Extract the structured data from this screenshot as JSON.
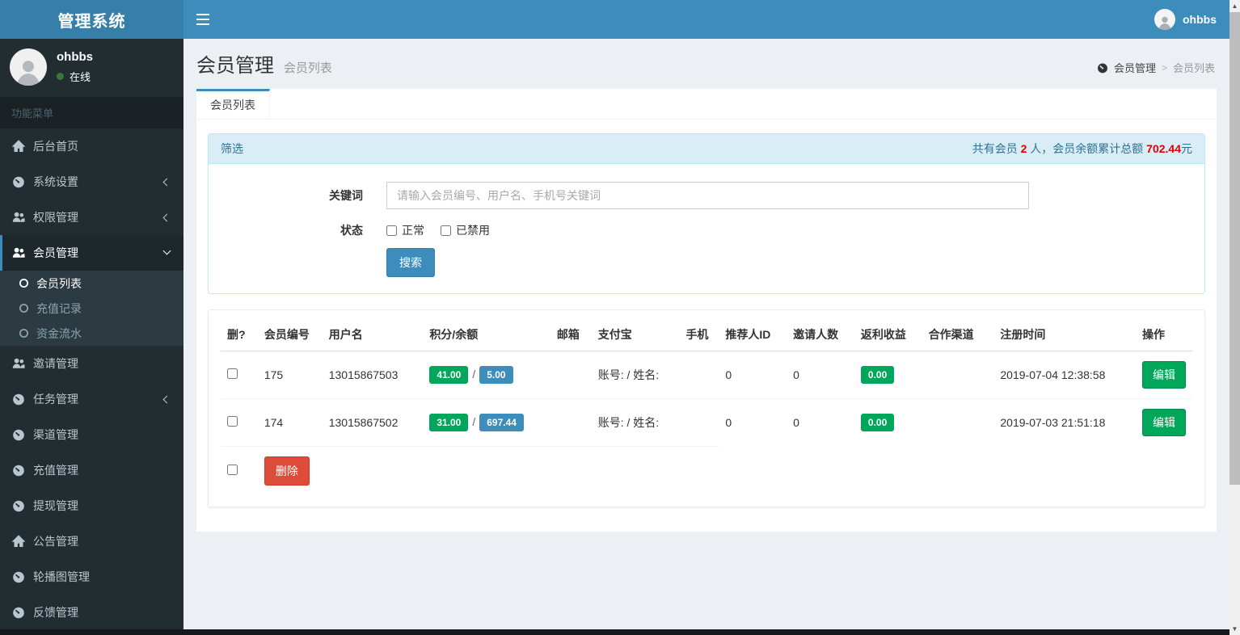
{
  "brand": {
    "title": "管理系统"
  },
  "navbar": {
    "user_name": "ohbbs"
  },
  "sidebar": {
    "user": {
      "name": "ohbbs",
      "status": "在线"
    },
    "section_header": "功能菜单",
    "items": [
      {
        "label": "后台首页",
        "icon": "home-icon"
      },
      {
        "label": "系统设置",
        "icon": "gauge-icon"
      },
      {
        "label": "权限管理",
        "icon": "users-icon"
      },
      {
        "label": "会员管理",
        "icon": "users-icon",
        "children": [
          {
            "label": "会员列表"
          },
          {
            "label": "充值记录"
          },
          {
            "label": "资金流水"
          }
        ]
      },
      {
        "label": "邀请管理",
        "icon": "users-icon"
      },
      {
        "label": "任务管理",
        "icon": "gauge-icon"
      },
      {
        "label": "渠道管理",
        "icon": "gauge-icon"
      },
      {
        "label": "充值管理",
        "icon": "gauge-icon"
      },
      {
        "label": "提现管理",
        "icon": "gauge-icon"
      },
      {
        "label": "公告管理",
        "icon": "home-icon"
      },
      {
        "label": "轮播图管理",
        "icon": "gauge-icon"
      },
      {
        "label": "反馈管理",
        "icon": "gauge-icon"
      }
    ]
  },
  "page": {
    "title": "会员管理",
    "subtitle": "会员列表",
    "tab": "会员列表",
    "breadcrumb": {
      "root": "会员管理",
      "sep": ">",
      "current": "会员列表"
    }
  },
  "filter": {
    "title": "筛选",
    "summary": {
      "prefix": "共有会员 ",
      "count": "2",
      "middle": " 人，会员余额累计总额 ",
      "total": "702.44",
      "suffix": "元"
    },
    "keyword_label": "关键词",
    "keyword_placeholder": "请输入会员编号、用户名、手机号关键词",
    "status_label": "状态",
    "status_options": [
      "正常",
      "已禁用"
    ],
    "search_button": "搜索"
  },
  "table": {
    "headers": [
      "删?",
      "会员编号",
      "用户名",
      "积分/余额",
      "邮箱",
      "支付宝",
      "手机",
      "推荐人ID",
      "邀请人数",
      "返利收益",
      "合作渠道",
      "注册时间",
      "操作"
    ],
    "rows": [
      {
        "id": "175",
        "username": "13015867503",
        "points": "41.00",
        "balance": "5.00",
        "email": "",
        "alipay": "账号: / 姓名:",
        "phone": "",
        "referrer_id": "0",
        "invite_count": "0",
        "rebate": "0.00",
        "channel": "",
        "register_time": "2019-07-04 12:38:58",
        "edit_label": "编辑"
      },
      {
        "id": "174",
        "username": "13015867502",
        "points": "31.00",
        "balance": "697.44",
        "email": "",
        "alipay": "账号: / 姓名:",
        "phone": "",
        "referrer_id": "0",
        "invite_count": "0",
        "rebate": "0.00",
        "channel": "",
        "register_time": "2019-07-03 21:51:18",
        "edit_label": "编辑"
      }
    ],
    "delete_button": "删除"
  },
  "colors": {
    "primary": "#3c8dbc",
    "logo-bg": "#367fa9",
    "sidebar-bg": "#222d32",
    "sidebar-dark": "#1a2226",
    "submenu-bg": "#2c3b41",
    "active-item": "#1e282c",
    "sidebar-text": "#b8c7ce",
    "sidebar-header": "#4b646f",
    "content-bg": "#ecf0f5",
    "info-border": "#bce8f1",
    "info-bg": "#d9edf7",
    "info-text": "#31708f",
    "success": "#00a65a",
    "danger": "#dd4b39",
    "red": "#e00000",
    "online": "#3c763d"
  }
}
